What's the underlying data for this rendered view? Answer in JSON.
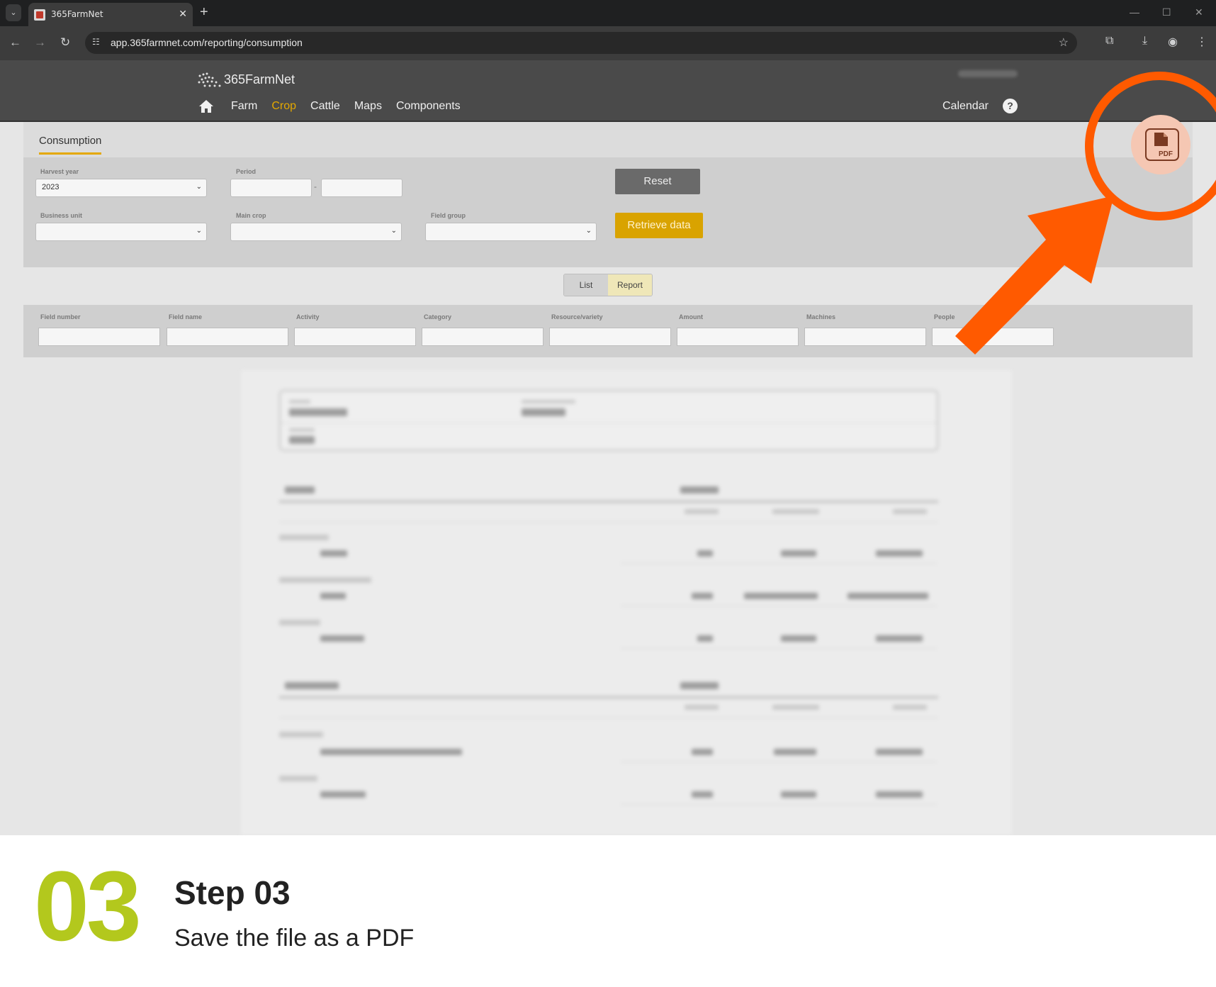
{
  "browser": {
    "tab_title": "365FarmNet",
    "url": "app.365farmnet.com/reporting/consumption"
  },
  "app": {
    "logo_text": "365FarmNet",
    "nav": [
      "Farm",
      "Crop",
      "Cattle",
      "Maps",
      "Components"
    ],
    "active_nav": "Crop",
    "calendar": "Calendar",
    "help": "?"
  },
  "subhead": {
    "tab": "Consumption"
  },
  "filters": {
    "harvest_year_label": "Harvest year",
    "harvest_year_value": "2023",
    "period_label": "Period",
    "period_sep": "-",
    "business_unit_label": "Business unit",
    "main_crop_label": "Main crop",
    "field_group_label": "Field group",
    "reset": "Reset",
    "retrieve": "Retrieve data"
  },
  "view_toggle": {
    "list": "List",
    "report": "Report",
    "selected": "Report"
  },
  "columns": [
    "Field number",
    "Field name",
    "Activity",
    "Category",
    "Resource/variety",
    "Amount",
    "Machines",
    "People"
  ],
  "pdf_button": {
    "label": "PDF"
  },
  "annotation": {
    "color": "#ff5a00"
  },
  "caption": {
    "number": "03",
    "title": "Step 03",
    "description": "Save the file as a PDF",
    "number_color": "#b3c81d"
  }
}
